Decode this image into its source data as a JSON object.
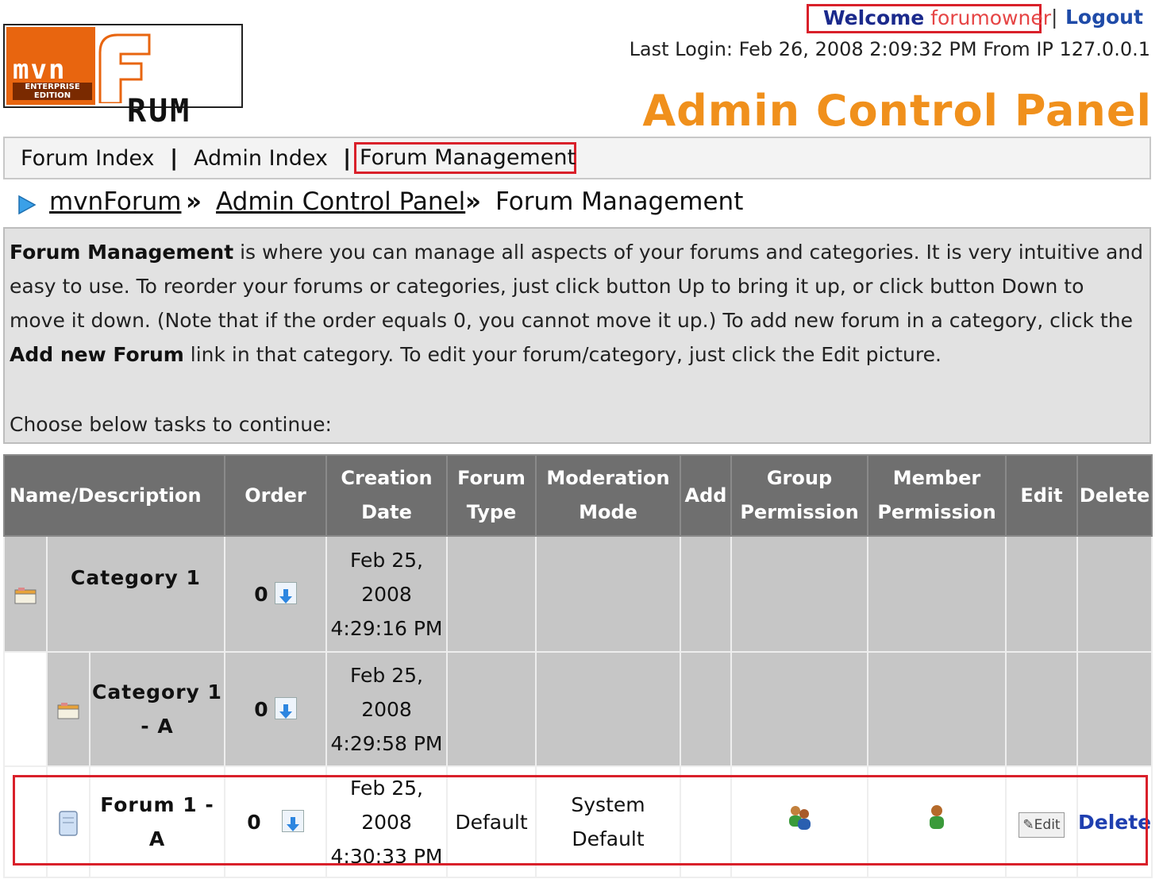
{
  "header": {
    "logo": {
      "mvn": "mvn",
      "edition": "ENTERPRISE EDITION",
      "forum": "RUM"
    },
    "welcome_label": "Welcome",
    "username": "forumowner",
    "separator": "|",
    "logout_label": "Logout",
    "last_login": "Last Login: Feb 26, 2008 2:09:32 PM From IP 127.0.0.1",
    "panel_title": "Admin Control Panel"
  },
  "nav": {
    "items": [
      {
        "label": "Forum Index"
      },
      {
        "label": "Admin Index"
      },
      {
        "label": "Forum Management"
      }
    ],
    "separator": "|"
  },
  "breadcrumb": {
    "items": [
      "mvnForum",
      "Admin Control Panel"
    ],
    "current": "Forum Management",
    "separator": "»"
  },
  "description": {
    "bold_lead": "Forum Management",
    "text1": " is where you can manage all aspects of your forums and categories. It is very intuitive and easy to use. To reorder your forums or categories, just click button Up to bring it up, or click button Down to move it down. (Note that if the order equals 0, you cannot move it up.) To add new forum in a category, click the ",
    "bold_link": "Add new Forum",
    "text2": " link in that category. To edit your forum/category, just click the Edit picture.",
    "choose": "Choose below tasks to continue:"
  },
  "table": {
    "headers": {
      "name": "Name/Description",
      "order": "Order",
      "creation": "Creation Date",
      "forum_type": "Forum Type",
      "moderation": "Moderation Mode",
      "add": "Add",
      "group_perm": "Group Permission",
      "member_perm": "Member Permission",
      "edit": "Edit",
      "delete": "Delete"
    },
    "rows": [
      {
        "name": "Category 1",
        "order": "0",
        "date": "Feb 25, 2008 4:29:16 PM"
      },
      {
        "name": "Category 1 - A",
        "order": "0",
        "date": "Feb 25, 2008 4:29:58 PM"
      },
      {
        "name": "Forum 1 - A",
        "order": "0",
        "date": "Feb 25, 2008 4:30:33 PM",
        "forum_type": "Default",
        "moderation": "System Default",
        "edit_label": "Edit",
        "delete_label": "Delete"
      }
    ]
  },
  "colors": {
    "accent_orange": "#f0901c",
    "highlight_red": "#d9202a",
    "link_blue": "#1f3fb0",
    "header_gray": "#6f6f6f"
  }
}
